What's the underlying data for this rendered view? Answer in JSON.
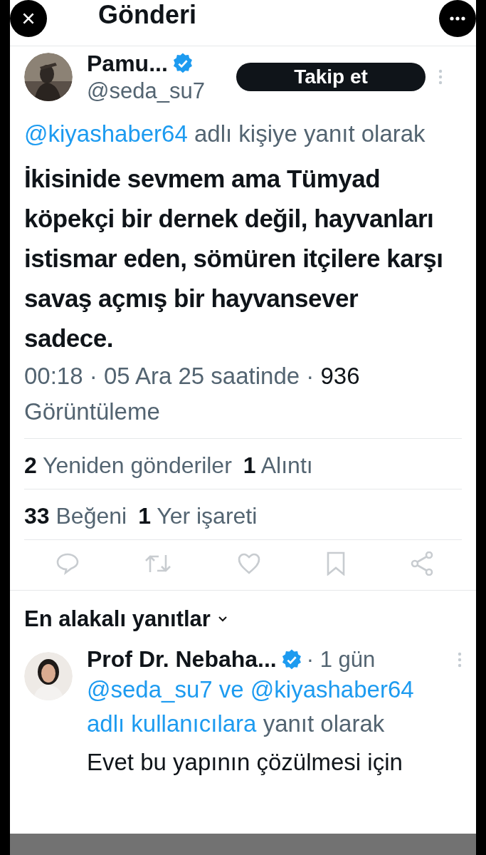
{
  "header": {
    "title": "Gönderi"
  },
  "post": {
    "author": {
      "name": "Pamu...",
      "handle": "@seda_su7",
      "verified": true
    },
    "follow_button": "Takip et",
    "reply_context": {
      "mention": "@kiyashaber64",
      "text": "adlı kişiye yanıt olarak"
    },
    "text": "İkisinide sevmem ama Tümyad köpekçi bir dernek değil, hayvanları istismar eden, sömüren itçilere karşı savaş açmış bir hayvansever sadece.",
    "meta": {
      "time": "00:18 · 05 Ara 25 saatinde ·",
      "views": "936",
      "views_label": "Görüntüleme"
    },
    "stats": [
      [
        {
          "count": "2",
          "label": "Yeniden gönderiler"
        },
        {
          "count": "1",
          "label": "Alıntı"
        }
      ],
      [
        {
          "count": "33",
          "label": "Beğeni"
        },
        {
          "count": "1",
          "label": "Yer işareti"
        }
      ]
    ]
  },
  "replies_header": "En alakalı yanıtlar",
  "reply": {
    "author": {
      "name": "Prof Dr. Nebaha...",
      "verified": true,
      "time": "· 1 gün"
    },
    "mentions": [
      "@seda_su7 ve @kiyashaber64",
      "adlı kullanıcılara"
    ],
    "context": "yanıt olarak",
    "text": "Evet bu yapının çözülmesi için"
  }
}
